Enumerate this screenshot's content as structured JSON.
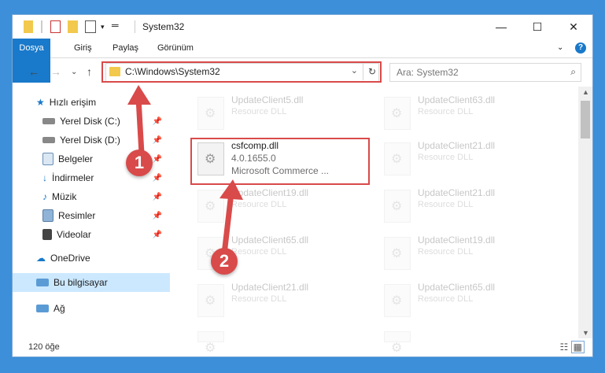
{
  "window": {
    "title": "System32",
    "minimize_icon": "minimize-icon",
    "maximize_icon": "maximize-icon",
    "close_icon": "close-icon"
  },
  "ribbon": {
    "tabs": [
      "Dosya",
      "Giriş",
      "Paylaş",
      "Görünüm"
    ],
    "help": "?"
  },
  "address": {
    "path": "C:\\Windows\\System32",
    "refresh_icon": "refresh-icon"
  },
  "search": {
    "placeholder": "Ara: System32"
  },
  "nav": {
    "items": [
      {
        "label": "Hızlı erişim",
        "icon": "star-icon",
        "pinned": false
      },
      {
        "label": "Yerel Disk (C:)",
        "icon": "drive-icon",
        "pinned": true
      },
      {
        "label": "Yerel Disk (D:)",
        "icon": "drive-icon",
        "pinned": true
      },
      {
        "label": "Belgeler",
        "icon": "documents-icon",
        "pinned": true
      },
      {
        "label": "İndirmeler",
        "icon": "download-icon",
        "pinned": true
      },
      {
        "label": "Müzik",
        "icon": "music-icon",
        "pinned": true
      },
      {
        "label": "Resimler",
        "icon": "pictures-icon",
        "pinned": true
      },
      {
        "label": "Videolar",
        "icon": "videos-icon",
        "pinned": true
      },
      {
        "label": "OneDrive",
        "icon": "cloud-icon",
        "pinned": false
      },
      {
        "label": "Bu bilgisayar",
        "icon": "computer-icon",
        "pinned": false
      },
      {
        "label": "Ağ",
        "icon": "network-icon",
        "pinned": false
      }
    ]
  },
  "files": [
    {
      "name": "UpdateClient5.dll",
      "desc": "Resource DLL"
    },
    {
      "name": "UpdateClient63.dll",
      "desc": "Resource DLL"
    },
    {
      "name": "csfcomp.dll",
      "line2": "4.0.1655.0",
      "line3": "Microsoft Commerce ..."
    },
    {
      "name": "UpdateClient21.dll",
      "desc": "Resource DLL"
    },
    {
      "name": "UpdateClient19.dll",
      "desc": "Resource DLL"
    },
    {
      "name": "UpdateClient21.dll",
      "desc": "Resource DLL"
    },
    {
      "name": "UpdateClient65.dll",
      "desc": "Resource DLL"
    },
    {
      "name": "UpdateClient19.dll",
      "desc": "Resource DLL"
    },
    {
      "name": "UpdateClient21.dll",
      "desc": "Resource DLL"
    },
    {
      "name": "UpdateClient65.dll",
      "desc": "Resource DLL"
    }
  ],
  "status": {
    "count": "120 öğe"
  },
  "callouts": [
    "1",
    "2"
  ],
  "colors": {
    "accent": "#1979ca",
    "highlight": "#d94a4a",
    "selection": "#cce8ff"
  }
}
